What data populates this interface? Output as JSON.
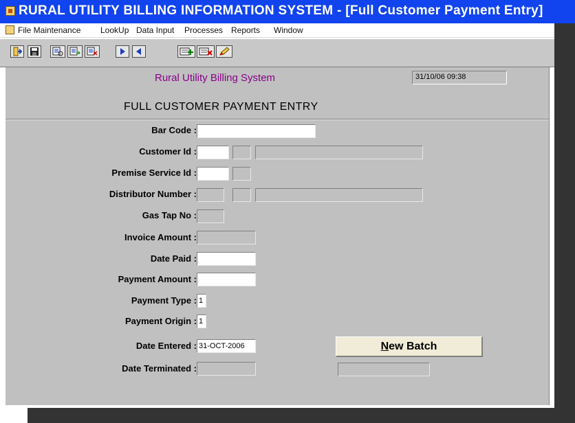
{
  "window": {
    "title": "RURAL UTILITY BILLING INFORMATION SYSTEM - [Full Customer Payment Entry]"
  },
  "menu": [
    "File Maintenance",
    "LookUp",
    "Data Input",
    "Processes",
    "Reports",
    "Window"
  ],
  "toolbar": {
    "icons": [
      "exit-icon",
      "save-icon",
      "query-icon",
      "execute-query-icon",
      "cancel-query-icon",
      "next-record-icon",
      "previous-record-icon",
      "insert-record-icon",
      "delete-record-icon",
      "edit-icon"
    ]
  },
  "header": {
    "app_title": "Rural Utility Billing System",
    "datetime": "31/10/06 09:38"
  },
  "form": {
    "title": "FULL CUSTOMER PAYMENT ENTRY",
    "fields": {
      "bar_code": {
        "label": "Bar Code :",
        "value": ""
      },
      "customer_id": {
        "label": "Customer Id :",
        "value": "",
        "code": "",
        "name": ""
      },
      "premise_service_id": {
        "label": "Premise Service Id :",
        "value": "",
        "code": ""
      },
      "distributor_number": {
        "label": "Distributor Number :",
        "value": "",
        "code": "",
        "name": ""
      },
      "gas_tap_no": {
        "label": "Gas Tap No :",
        "value": ""
      },
      "invoice_amount": {
        "label": "Invoice Amount :",
        "value": ""
      },
      "date_paid": {
        "label": "Date Paid :",
        "value": ""
      },
      "payment_amount": {
        "label": "Payment Amount :",
        "value": ""
      },
      "payment_type": {
        "label": "Payment Type :",
        "value": "1"
      },
      "payment_origin": {
        "label": "Payment Origin :",
        "value": "1"
      },
      "date_entered": {
        "label": "Date Entered :",
        "value": "31-OCT-2006"
      },
      "date_terminated": {
        "label": "Date Terminated :",
        "value": ""
      },
      "batch_info": {
        "value": ""
      }
    },
    "new_batch": {
      "label_underlined": "N",
      "label_rest": "ew Batch"
    }
  }
}
